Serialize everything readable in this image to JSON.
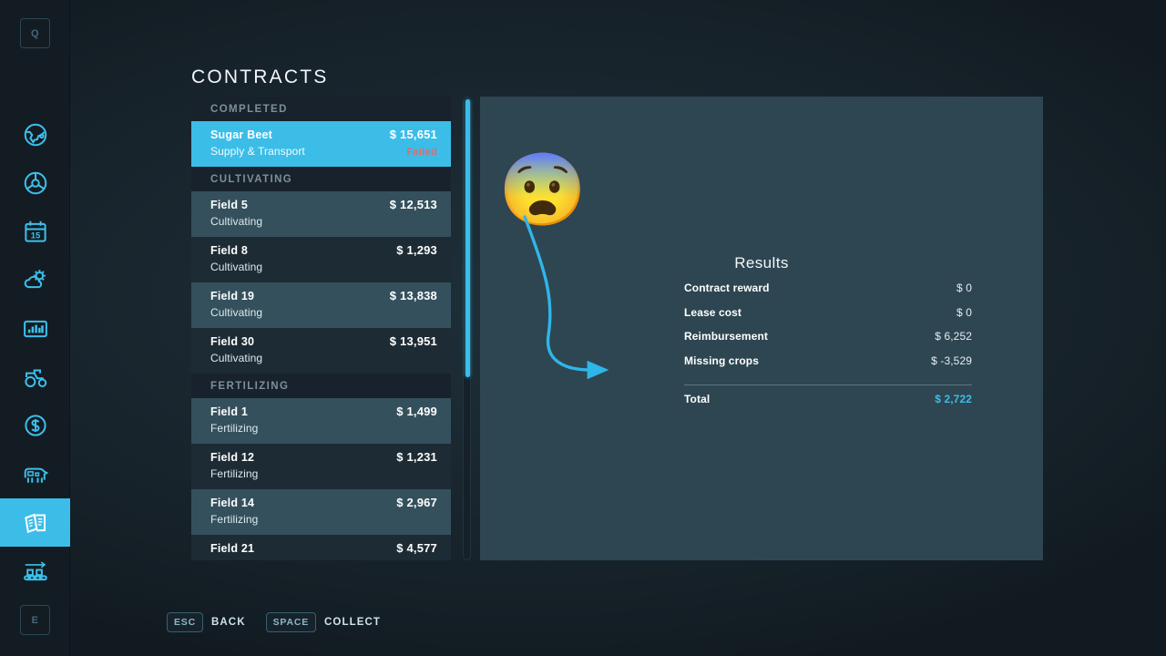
{
  "app": {
    "page_title": "CONTRACTS",
    "accent_color": "#3bbde8",
    "panel_color": "#2e4651",
    "failed_color": "#e36b6b"
  },
  "sidebar": {
    "top_key": "Q",
    "bottom_key": "E",
    "items": [
      {
        "name": "map-globe-icon",
        "label": "Map"
      },
      {
        "name": "steering-wheel-icon",
        "label": "Vehicles"
      },
      {
        "name": "calendar-icon",
        "label": "Calendar",
        "day": "15"
      },
      {
        "name": "weather-icon",
        "label": "Weather"
      },
      {
        "name": "statistics-icon",
        "label": "Statistics"
      },
      {
        "name": "tractor-icon",
        "label": "Vehicles"
      },
      {
        "name": "finances-icon",
        "label": "Finances"
      },
      {
        "name": "animals-icon",
        "label": "Animals"
      },
      {
        "name": "contracts-icon",
        "label": "Contracts",
        "active": true
      },
      {
        "name": "production-icon",
        "label": "Production"
      }
    ]
  },
  "contract_list": {
    "groups": [
      {
        "header": "COMPLETED",
        "rows": [
          {
            "name": "Sugar Beet",
            "sub": "Supply & Transport",
            "price": "$ 15,651",
            "status": "Failed",
            "selected": true
          }
        ]
      },
      {
        "header": "CULTIVATING",
        "rows": [
          {
            "name": "Field 5",
            "sub": "Cultivating",
            "price": "$ 12,513"
          },
          {
            "name": "Field 8",
            "sub": "Cultivating",
            "price": "$ 1,293"
          },
          {
            "name": "Field 19",
            "sub": "Cultivating",
            "price": "$ 13,838"
          },
          {
            "name": "Field 30",
            "sub": "Cultivating",
            "price": "$ 13,951"
          }
        ]
      },
      {
        "header": "FERTILIZING",
        "rows": [
          {
            "name": "Field 1",
            "sub": "Fertilizing",
            "price": "$ 1,499"
          },
          {
            "name": "Field 12",
            "sub": "Fertilizing",
            "price": "$ 1,231"
          },
          {
            "name": "Field 14",
            "sub": "Fertilizing",
            "price": "$ 2,967"
          },
          {
            "name": "Field 21",
            "sub": "Fertilizing",
            "price": "$ 4,577"
          }
        ]
      }
    ]
  },
  "results": {
    "title": "Results",
    "rows": [
      {
        "label": "Contract reward",
        "value": "$ 0"
      },
      {
        "label": "Lease cost",
        "value": "$ 0"
      },
      {
        "label": "Reimbursement",
        "value": "$ 6,252"
      },
      {
        "label": "Missing crops",
        "value": "$ -3,529"
      }
    ],
    "total": {
      "label": "Total",
      "value": "$ 2,722"
    }
  },
  "annotation": {
    "emoji": "😨",
    "points_to": "Missing crops"
  },
  "help_bar": [
    {
      "key": "ESC",
      "label": "BACK"
    },
    {
      "key": "SPACE",
      "label": "COLLECT"
    }
  ]
}
